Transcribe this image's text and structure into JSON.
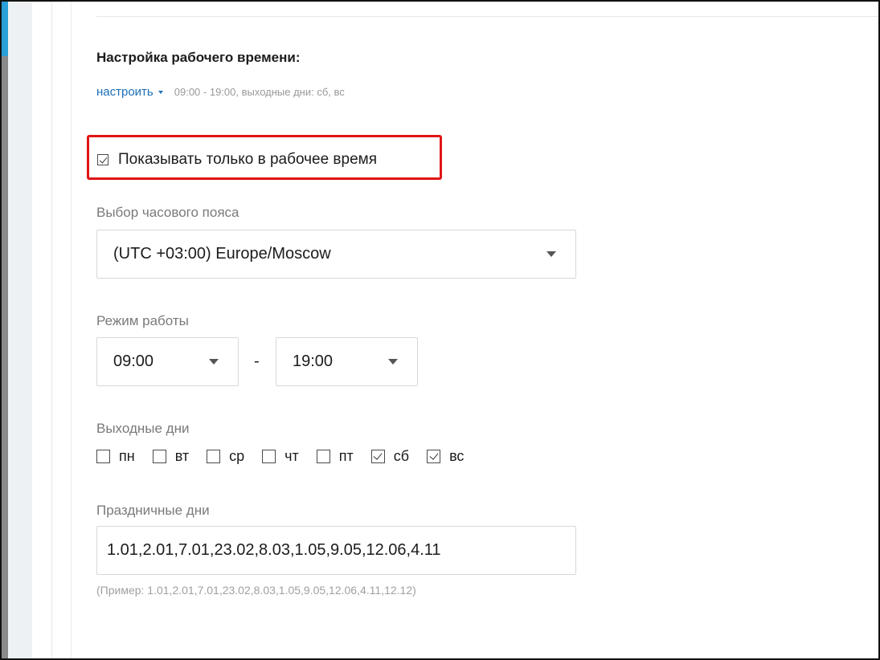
{
  "section": {
    "title": "Настройка рабочего времени:",
    "configure_link": "настроить",
    "summary": "09:00 - 19:00, выходные дни: сб, вс"
  },
  "only_work_time": {
    "label": "Показывать только в рабочее время",
    "checked": true
  },
  "timezone": {
    "label": "Выбор часового пояса",
    "value": "(UTC +03:00) Europe/Moscow"
  },
  "work_mode": {
    "label": "Режим работы",
    "from": "09:00",
    "separator": "-",
    "to": "19:00"
  },
  "weekends": {
    "label": "Выходные дни",
    "days": [
      {
        "label": "пн",
        "checked": false
      },
      {
        "label": "вт",
        "checked": false
      },
      {
        "label": "ср",
        "checked": false
      },
      {
        "label": "чт",
        "checked": false
      },
      {
        "label": "пт",
        "checked": false
      },
      {
        "label": "сб",
        "checked": true
      },
      {
        "label": "вс",
        "checked": true
      }
    ]
  },
  "holidays": {
    "label": "Праздничные дни",
    "value": "1.01,2.01,7.01,23.02,8.03,1.05,9.05,12.06,4.11",
    "hint": "(Пример: 1.01,2.01,7.01,23.02,8.03,1.05,9.05,12.06,4.11,12.12)"
  },
  "colors": {
    "link": "#1c6fb8",
    "highlight": "#e01414",
    "sidebar_accent": "#2aa0d8"
  }
}
